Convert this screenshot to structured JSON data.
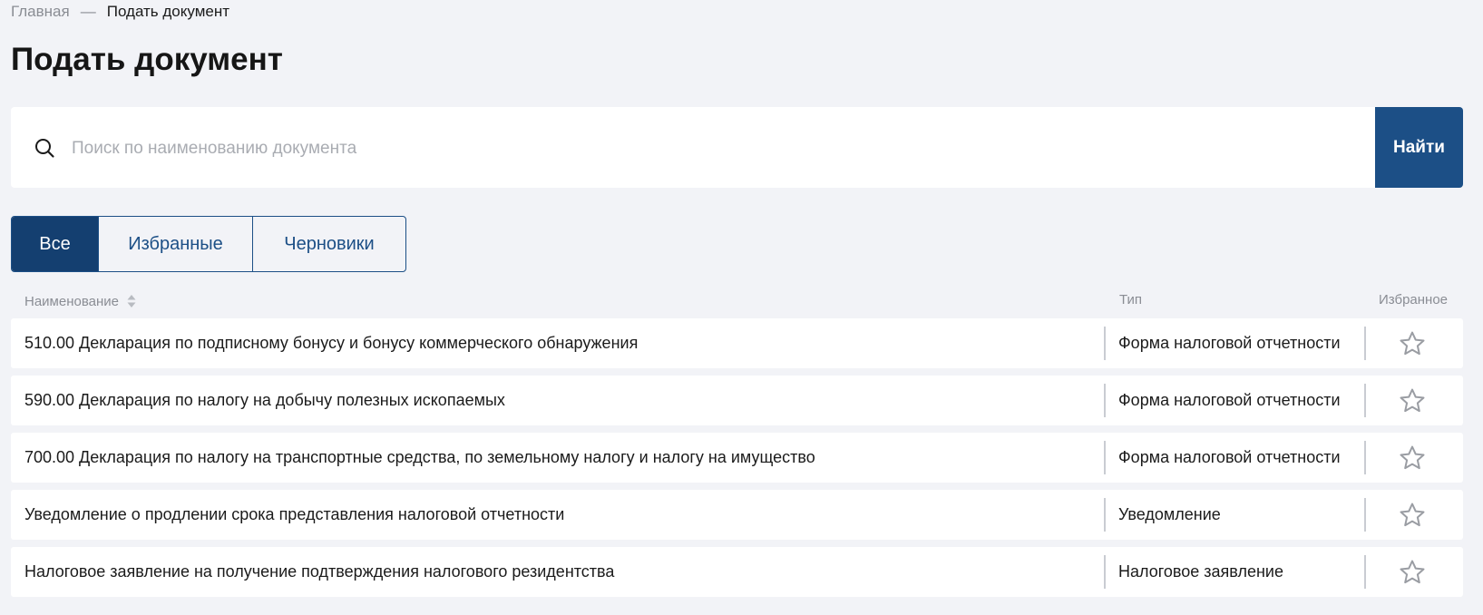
{
  "breadcrumb": {
    "home": "Главная",
    "separator": "—",
    "current": "Подать документ"
  },
  "page_title": "Подать документ",
  "search": {
    "placeholder": "Поиск по наименованию документа",
    "value": "",
    "button_label": "Найти",
    "icon": "search-icon"
  },
  "tabs": [
    {
      "label": "Все",
      "active": true
    },
    {
      "label": "Избранные",
      "active": false
    },
    {
      "label": "Черновики",
      "active": false
    }
  ],
  "table": {
    "columns": {
      "name": "Наименование",
      "type": "Тип",
      "favorite": "Избранное"
    },
    "rows": [
      {
        "name": "510.00 Декларация по подписному бонусу и бонусу коммерческого обнаружения",
        "type": "Форма налоговой отчетности",
        "favorite": false
      },
      {
        "name": "590.00 Декларация по налогу на добычу полезных ископаемых",
        "type": "Форма налоговой отчетности",
        "favorite": false
      },
      {
        "name": "700.00 Декларация по налогу на транспортные средства, по земельному налогу и налогу на имущество",
        "type": "Форма налоговой отчетности",
        "favorite": false
      },
      {
        "name": "Уведомление о продлении срока представления налоговой отчетности",
        "type": "Уведомление",
        "favorite": false
      },
      {
        "name": "Налоговое заявление на получение подтверждения налогового резидентства",
        "type": "Налоговое заявление",
        "favorite": false
      }
    ]
  },
  "colors": {
    "accent": "#1c4f86",
    "tab_active": "#143f70",
    "background": "#f2f3f7",
    "star_outline": "#9a9da3"
  }
}
